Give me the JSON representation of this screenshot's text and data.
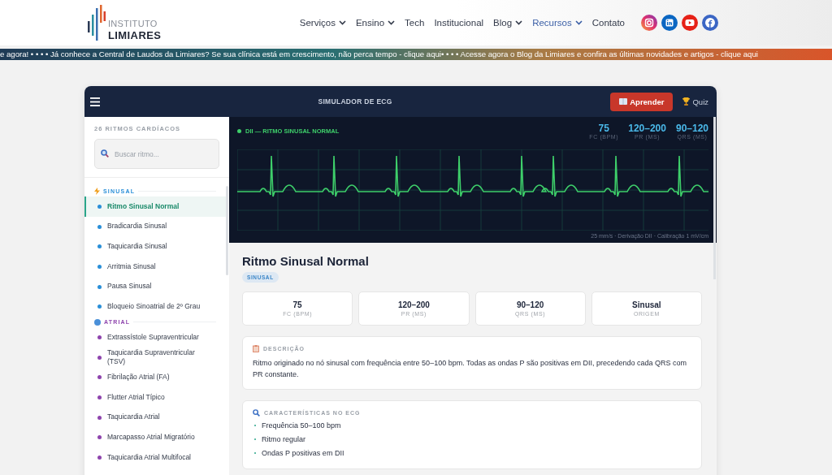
{
  "site": {
    "logo_top": "INSTITUTO",
    "logo_bottom": "LIMIARES",
    "nav": [
      {
        "label": "Serviços",
        "dropdown": true,
        "selected": false
      },
      {
        "label": "Ensino",
        "dropdown": true,
        "selected": false
      },
      {
        "label": "Tech",
        "dropdown": false,
        "selected": false
      },
      {
        "label": "Institucional",
        "dropdown": false,
        "selected": false
      },
      {
        "label": "Blog",
        "dropdown": true,
        "selected": false
      },
      {
        "label": "Recursos",
        "dropdown": true,
        "selected": true
      },
      {
        "label": "Contato",
        "dropdown": false,
        "selected": false
      }
    ],
    "social": [
      {
        "kind": "instagram"
      },
      {
        "kind": "linkedin"
      },
      {
        "kind": "youtube"
      },
      {
        "kind": "facebook"
      }
    ],
    "ticker": "e agora! • • • • Já conhece a Central de Laudos da Limiares? Se sua clínica está em crescimento, não perca tempo - clique aqui• • • • Acesse agora o Blog da Limiares e confira as últimas novidades e artigos - clique aqui"
  },
  "app": {
    "title": "SIMULADOR DE ECG",
    "learn_button": "Aprender",
    "quiz_button": "Quiz"
  },
  "sidebar": {
    "count_label": "26 RITMOS CARDÍACOS",
    "search": {
      "placeholder": "Buscar ritmo..."
    },
    "groups": [
      {
        "label": "SINUSAL",
        "color": "#2a8fd8",
        "items": [
          {
            "label": "Ritmo Sinusal Normal",
            "selected": true
          },
          {
            "label": "Bradicardia Sinusal",
            "selected": false
          },
          {
            "label": "Taquicardia Sinusal",
            "selected": false
          },
          {
            "label": "Arritmia Sinusal",
            "selected": false
          },
          {
            "label": "Pausa Sinusal",
            "selected": false
          },
          {
            "label": "Bloqueio Sinoatrial de 2º Grau",
            "selected": false
          }
        ]
      },
      {
        "label": "ATRIAL",
        "color": "#8e44ad",
        "items": [
          {
            "label": "Extrassístole Supraventricular",
            "selected": false
          },
          {
            "label": "Taquicardia Supraventricular (TSV)",
            "selected": false
          },
          {
            "label": "Fibrilação Atrial (FA)",
            "selected": false
          },
          {
            "label": "Flutter Atrial Típico",
            "selected": false
          },
          {
            "label": "Taquicardia Atrial",
            "selected": false
          },
          {
            "label": "Marcapasso Atrial Migratório",
            "selected": false
          },
          {
            "label": "Taquicardia Atrial Multifocal",
            "selected": false
          }
        ]
      }
    ]
  },
  "monitor": {
    "lead_label": "DII — RITMO SINUSAL NORMAL",
    "readings": [
      {
        "value": "75",
        "label": "FC (BPM)"
      },
      {
        "value": "120–200",
        "label": "PR (MS)"
      },
      {
        "value": "90–120",
        "label": "QRS (MS)"
      }
    ],
    "footer": "25 mm/s · Derivação DII · Calibração 1 mV/cm"
  },
  "rhythm": {
    "title": "Ritmo Sinusal Normal",
    "tag": "SINUSAL",
    "stats": [
      {
        "value": "75",
        "label": "FC (BPM)"
      },
      {
        "value": "120–200",
        "label": "PR (MS)"
      },
      {
        "value": "90–120",
        "label": "QRS (MS)"
      },
      {
        "value": "Sinusal",
        "label": "ORIGEM"
      }
    ],
    "description": {
      "heading": "DESCRIÇÃO",
      "text": "Ritmo originado no nó sinusal com frequência entre 50–100 bpm. Todas as ondas P são positivas em DII, precedendo cada QRS com PR constante."
    },
    "features": {
      "heading": "CARACTERÍSTICAS NO ECG",
      "items": [
        "Frequência 50–100 bpm",
        "Ritmo regular",
        "Ondas P positivas em DII"
      ]
    }
  }
}
